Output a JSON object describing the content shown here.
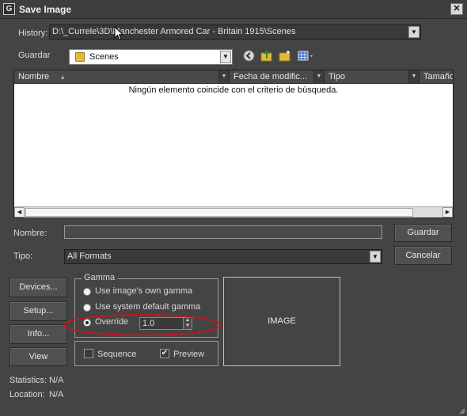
{
  "window": {
    "title": "Save Image",
    "close_glyph": "✕",
    "icon": "max-logo-icon"
  },
  "history": {
    "label": "History:",
    "value": "D:\\_Currele\\3D\\Manchester Armored Car - Britain 1915\\Scenes"
  },
  "guardar": {
    "label": "Guardar",
    "folder": "Scenes"
  },
  "toolbar_icons": [
    "back-icon",
    "up-folder-icon",
    "new-folder-icon",
    "view-menu-icon"
  ],
  "file_list": {
    "columns": [
      "Nombre",
      "Fecha de modific...",
      "Tipo",
      "Tamaño"
    ],
    "empty_message": "Ningún elemento coincide con el criterio de búsqueda."
  },
  "filename": {
    "label": "Nombre:",
    "value": ""
  },
  "filetype": {
    "label": "Tipo:",
    "value": "All Formats"
  },
  "buttons": {
    "save": "Guardar",
    "cancel": "Cancelar"
  },
  "side_buttons": {
    "devices": "Devices...",
    "setup": "Setup...",
    "info": "Info...",
    "view": "View"
  },
  "gamma": {
    "title": "Gamma",
    "options": [
      "Use image's own gamma",
      "Use system default gamma",
      "Override"
    ],
    "selected_index": 2,
    "override_value": "1.0"
  },
  "options": {
    "sequence_label": "Sequence",
    "sequence_checked": false,
    "preview_label": "Preview",
    "preview_checked": true
  },
  "image_preview": {
    "label": "IMAGE"
  },
  "statistics": {
    "label": "Statistics:",
    "value": "N/A"
  },
  "location": {
    "label": "Location:",
    "value": "N/A"
  },
  "colors": {
    "background": "#444444",
    "annotation": "#c0181c"
  }
}
